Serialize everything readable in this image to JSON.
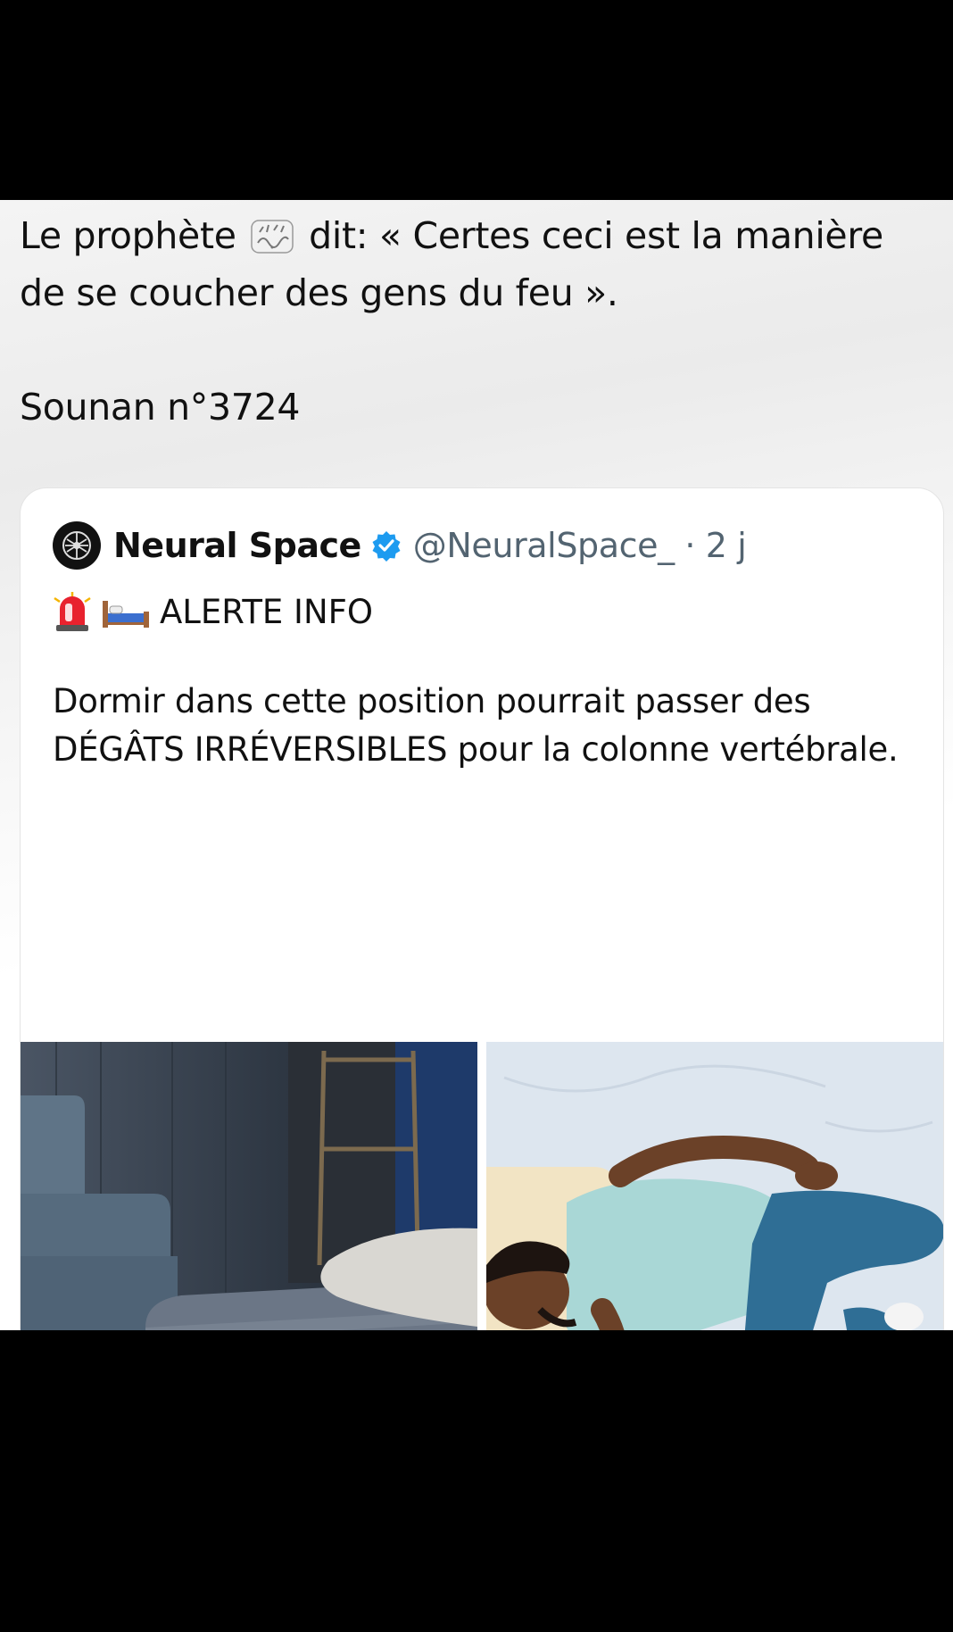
{
  "post": {
    "line1_a": "Le prophète",
    "line1_b": "dit: « Certes ceci est la manière",
    "line2": "de se coucher des gens du feu ».",
    "reference": "Sounan n°3724"
  },
  "quoted_post": {
    "author_name": "Neural Space",
    "handle_time": "@NeuralSpace_ · 2 j",
    "alert_label": "ALERTE INFO",
    "alert_icons": [
      "rotating-light-icon",
      "bed-icon"
    ],
    "body": "Dormir dans cette position pourrait passer des DÉGÂTS IRRÉVERSIBLES pour la colonne vertébrale.",
    "images": [
      "bedroom-photo",
      "man-sleeping-on-stomach-photo"
    ]
  },
  "colors": {
    "verified_blue": "#1d9bf0",
    "handle_gray": "#536471",
    "background_black": "#000000"
  }
}
